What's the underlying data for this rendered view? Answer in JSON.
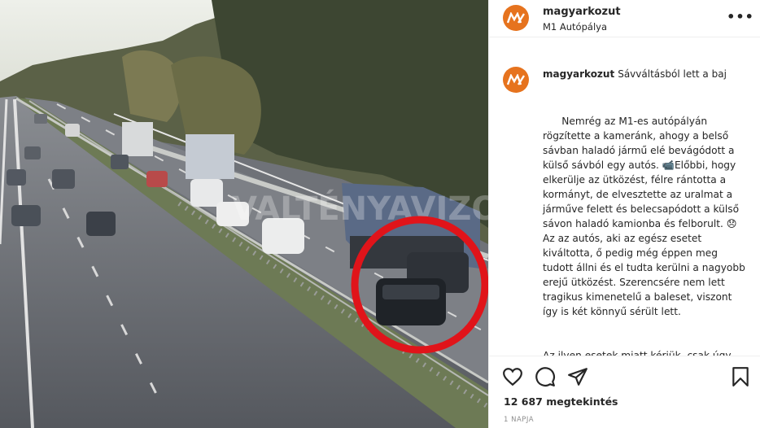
{
  "post": {
    "username": "magyarkozut",
    "location": "M1 Autópálya",
    "caption_title": "Sávváltásból lett a baj",
    "caption_p1": "Nemrég az M1-es autópályán rögzítette a kameránk, ahogy a belső sávban haladó jármű elé bevágódott a külső sávból egy autós. 📹Előbbi, hogy elkerülje az ütközést, félre rántotta a kormányt, de elvesztette az uralmat a járműve felett és belecsapódott a külső sávon haladó kamionba és felborult. 😞 Az az autós, aki az egész esetet kiváltotta, ő pedig még éppen meg tudott állni és el tudta kerülni a nagyobb erejű ütközést. Szerencsére nem lett tragikus kimenetelű a baleset, viszont így is két könnyű sérült lett.",
    "caption_p2": "Az ilyen esetek miatt kérjük, csak úgy váltsatok sávot, ha kellőképpen",
    "views": "12 687 megtekintés",
    "time_ago": "1 NAPJA"
  },
  "video": {
    "watermark": "VALTÉNYAVIZOTOR"
  },
  "icons": {
    "more": "more-icon",
    "like": "heart-icon",
    "comment": "comment-icon",
    "share": "share-icon",
    "save": "bookmark-icon"
  },
  "colors": {
    "brand_orange": "#e6731e",
    "highlight_red": "#e0141a"
  }
}
